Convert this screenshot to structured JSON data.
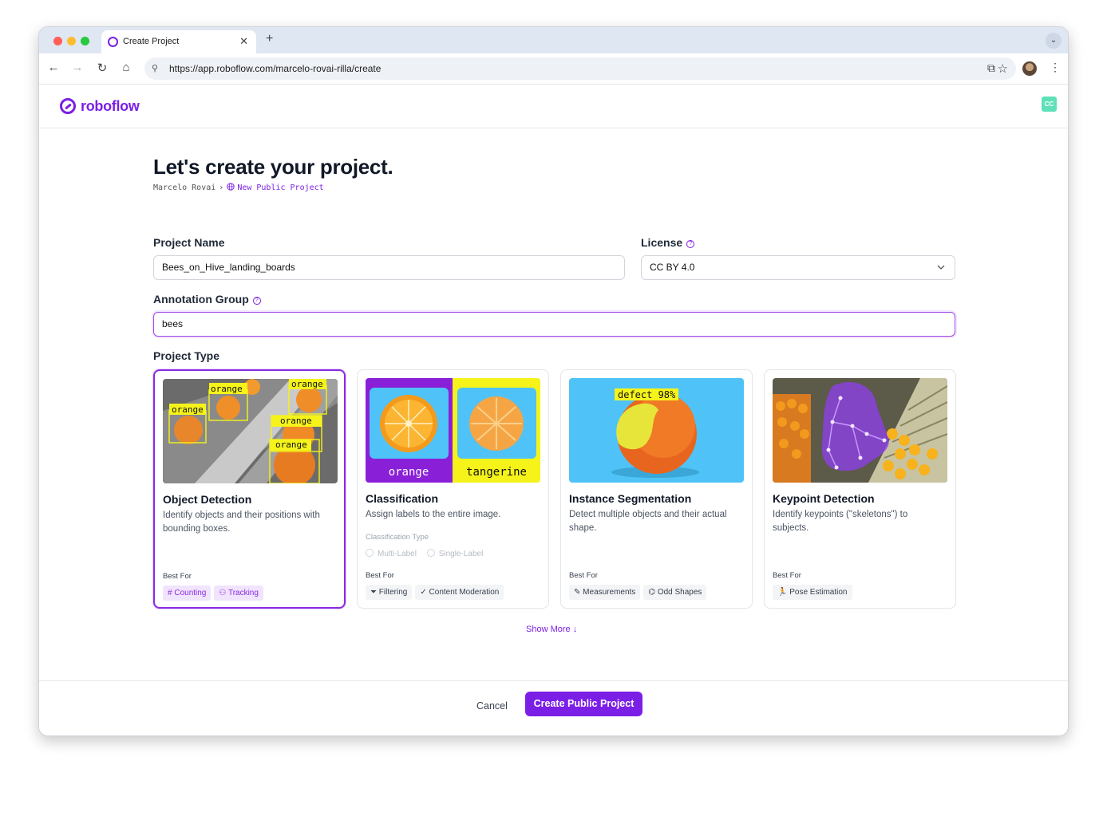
{
  "browser": {
    "tab_title": "Create Project",
    "tab_close": "✕",
    "new_tab": "+",
    "tab_menu": "⌄",
    "url": "https://app.roboflow.com/marcelo-rovai-rilla/create",
    "back": "←",
    "forward": "→",
    "reload": "↻",
    "home": "⌂",
    "site_info": "⚲",
    "bookmark": "☆",
    "extensions": "⧉",
    "menu": "⋮"
  },
  "app": {
    "logo": "roboflow",
    "user_initials": "CC"
  },
  "page": {
    "title": "Let's create your project.",
    "breadcrumb": {
      "owner": "Marcelo Rovai",
      "separator": "›",
      "current": "New Public Project",
      "current_icon": "globe-icon"
    },
    "form": {
      "project_name_label": "Project Name",
      "project_name_value": "Bees_on_Hive_landing_boards",
      "license_label": "License",
      "license_value": "CC BY 4.0",
      "annotation_group_label": "Annotation Group",
      "annotation_group_value": "bees",
      "project_type_label": "Project Type",
      "help_glyph": "?"
    },
    "project_types": [
      {
        "title": "Object Detection",
        "description": "Identify objects and their positions with bounding boxes.",
        "best_for_label": "Best For",
        "tags": [
          {
            "icon": "#",
            "label": "Counting"
          },
          {
            "icon": "⚇",
            "label": "Tracking"
          }
        ],
        "image_labels": [
          "orange",
          "orange",
          "orange",
          "orange",
          "orange"
        ],
        "selected": true
      },
      {
        "title": "Classification",
        "description": "Assign labels to the entire image.",
        "classification_type_label": "Classification Type",
        "options": [
          "Multi-Label",
          "Single-Label"
        ],
        "best_for_label": "Best For",
        "tags": [
          {
            "icon": "⏷",
            "label": "Filtering"
          },
          {
            "icon": "✓",
            "label": "Content Moderation"
          }
        ],
        "image_labels": [
          "orange",
          "tangerine"
        ],
        "selected": false
      },
      {
        "title": "Instance Segmentation",
        "description": "Detect multiple objects and their actual shape.",
        "best_for_label": "Best For",
        "tags": [
          {
            "icon": "✎",
            "label": "Measurements"
          },
          {
            "icon": "⌬",
            "label": "Odd Shapes"
          }
        ],
        "image_labels": [
          "defect 98%"
        ],
        "selected": false
      },
      {
        "title": "Keypoint Detection",
        "description": "Identify keypoints (\"skeletons\") to subjects.",
        "best_for_label": "Best For",
        "tags": [
          {
            "icon": "🏃",
            "label": "Pose Estimation"
          }
        ],
        "selected": false
      }
    ],
    "show_more": "Show More ↓",
    "footer": {
      "cancel": "Cancel",
      "create": "Create Public Project"
    }
  },
  "colors": {
    "brand": "#7c1fe6",
    "tab_bar": "#dfe7f3",
    "label_yellow": "#f5f31a",
    "sky_blue": "#4fc3f7"
  }
}
